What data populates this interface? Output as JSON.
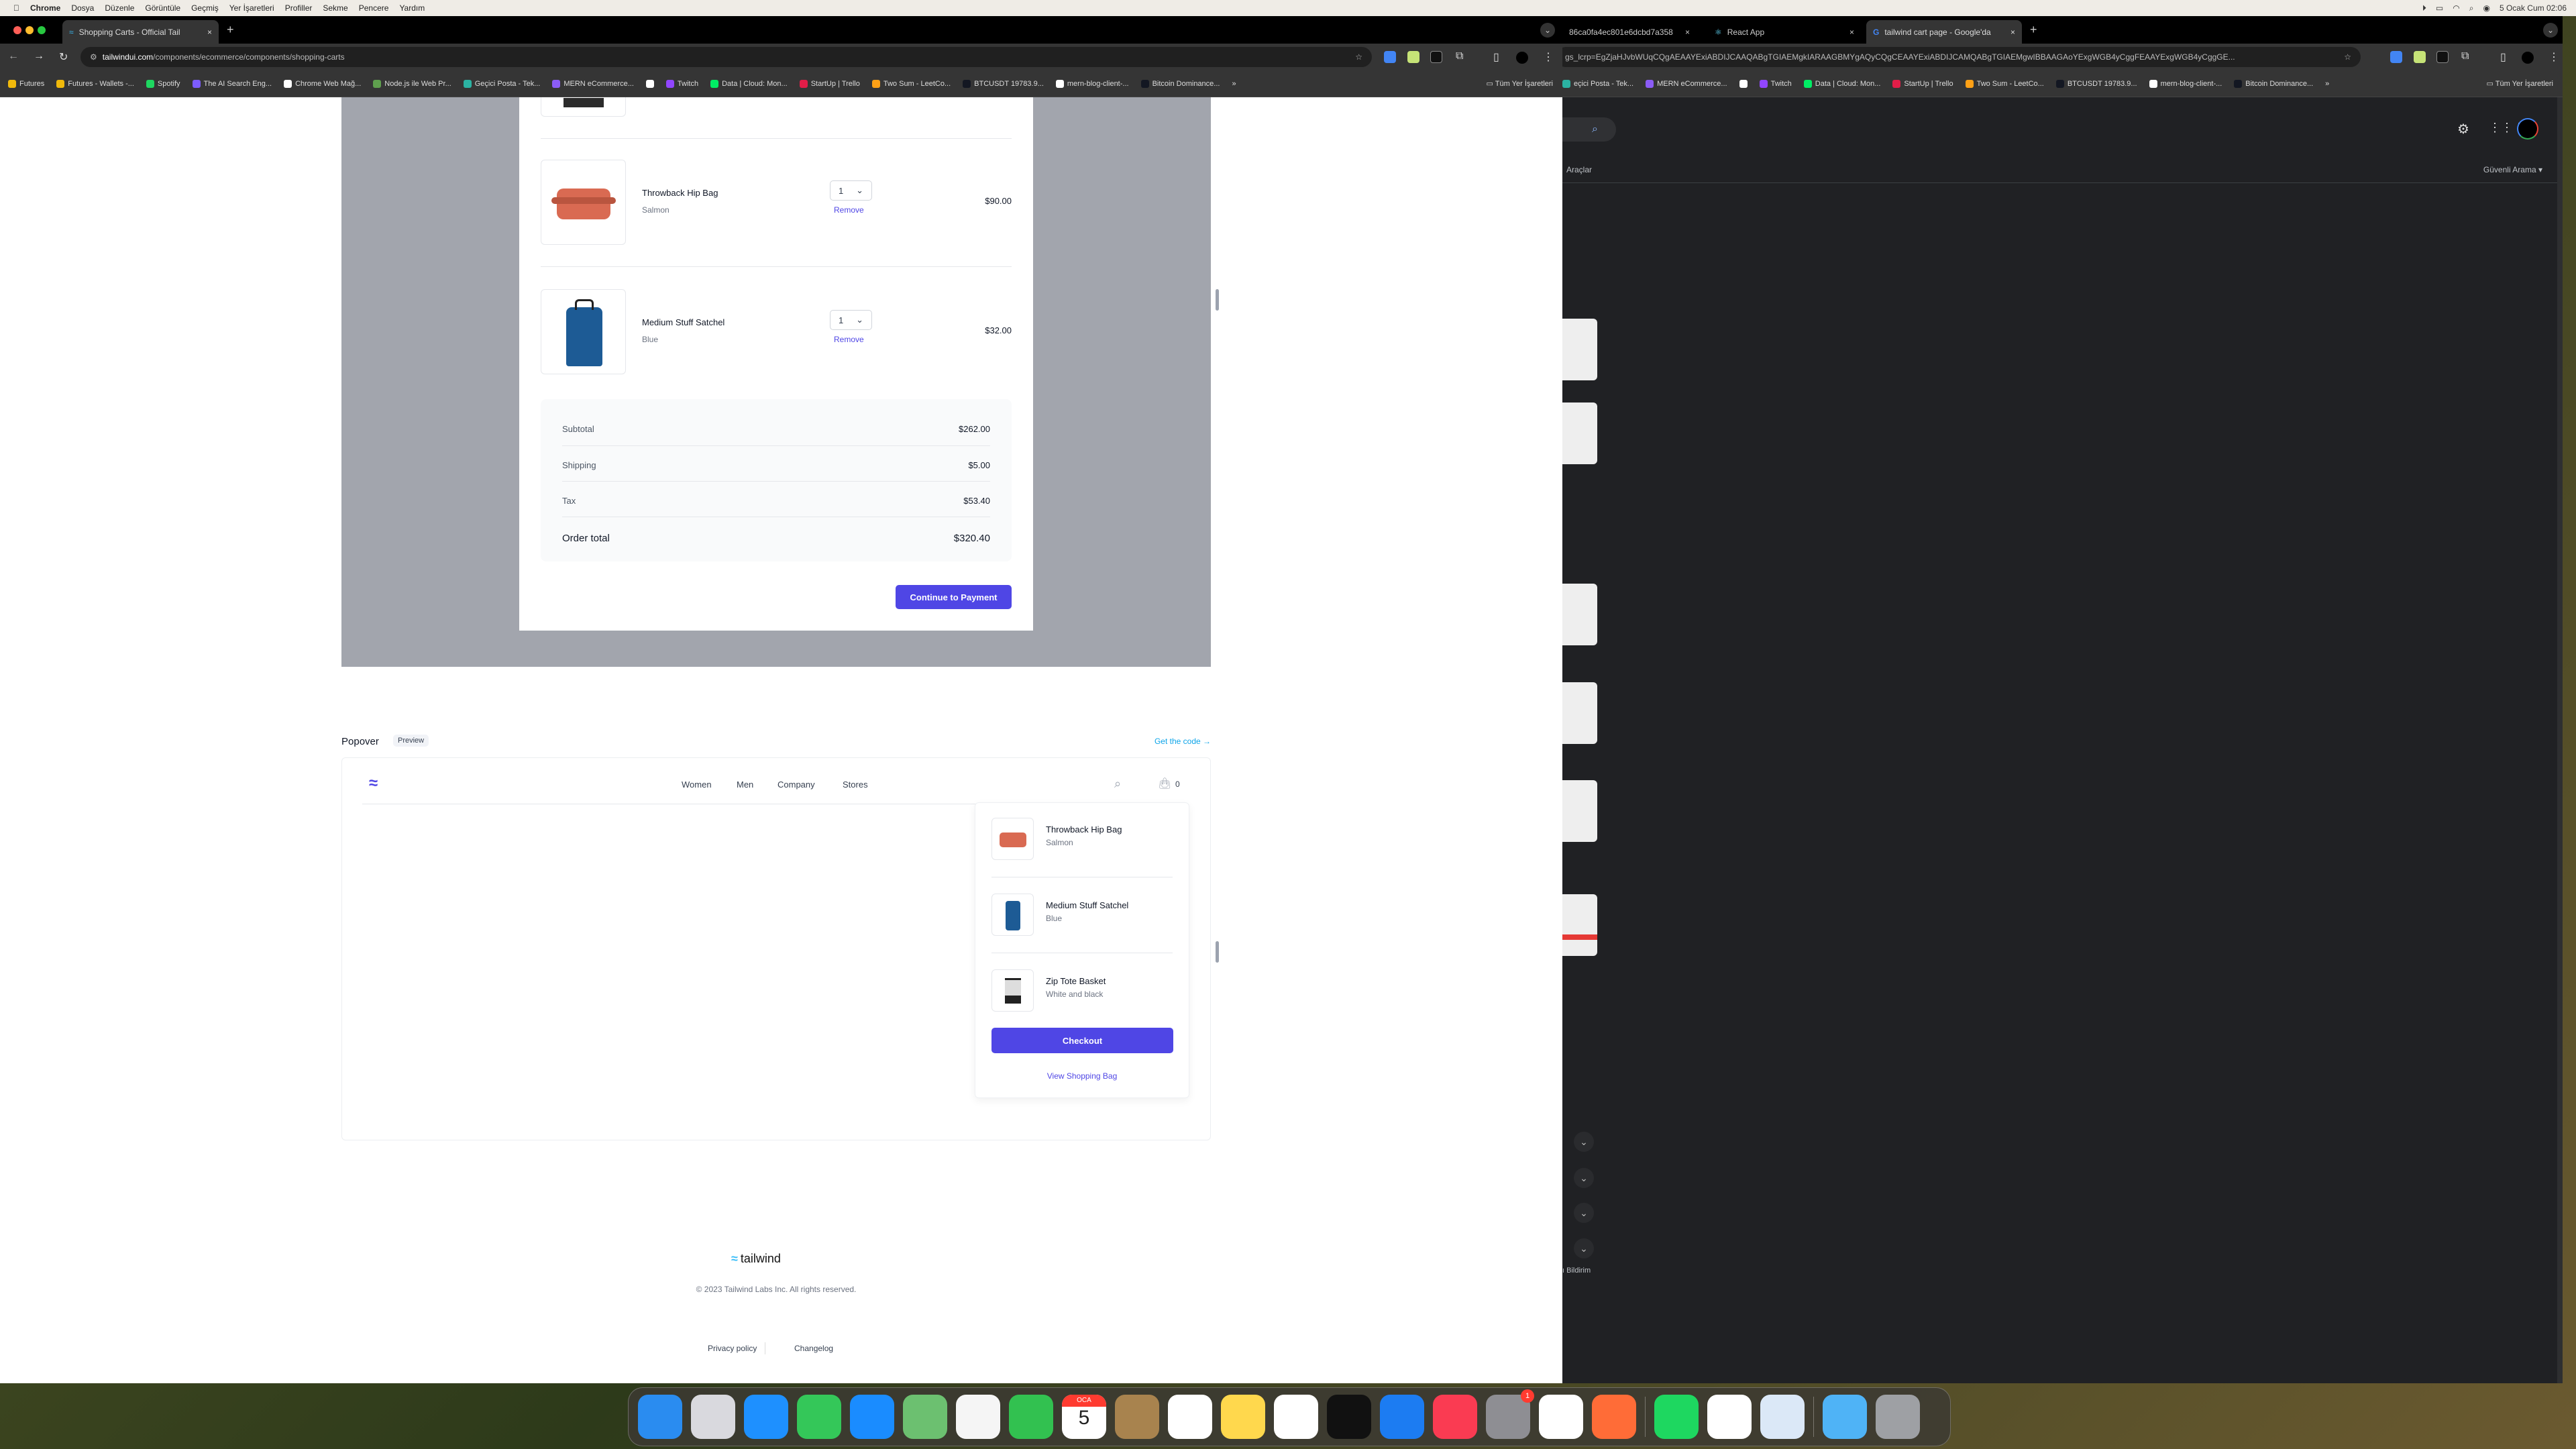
{
  "menubar": {
    "items": [
      "Chrome",
      "Dosya",
      "Düzenle",
      "Görüntüle",
      "Geçmiş",
      "Yer İşaretleri",
      "Profiller",
      "Sekme",
      "Pencere",
      "Yardım"
    ],
    "clock": "5 Ocak Cum 02:06"
  },
  "left_window": {
    "tab_title": "Shopping Carts - Official Tail",
    "url_host": "tailwindui.com",
    "url_path": "/components/ecommerce/components/shopping-carts",
    "bookmarks": [
      "Futures",
      "Futures - Wallets -...",
      "Spotify",
      "The AI Search Eng...",
      "Chrome Web Mağ...",
      "Node.js ile Web Pr...",
      "Geçici Posta - Tek...",
      "MERN eCommerce...",
      "",
      "Twitch",
      "Data | Cloud: Mon...",
      "StartUp | Trello",
      "Two Sum - LeetCo...",
      "BTCUSDT 19783.9...",
      "mern-blog-client-...",
      "Bitcoin Dominance..."
    ],
    "more": "»",
    "all_bookmarks": "Tüm Yer İşaretleri"
  },
  "cart": {
    "items": [
      {
        "name": "Throwback Hip Bag",
        "color": "Salmon",
        "qty": "1",
        "remove": "Remove",
        "price": "$90.00"
      },
      {
        "name": "Medium Stuff Satchel",
        "color": "Blue",
        "qty": "1",
        "remove": "Remove",
        "price": "$32.00"
      }
    ],
    "summary": [
      {
        "label": "Subtotal",
        "value": "$262.00"
      },
      {
        "label": "Shipping",
        "value": "$5.00"
      },
      {
        "label": "Tax",
        "value": "$53.40"
      }
    ],
    "total": {
      "label": "Order total",
      "value": "$320.40"
    },
    "continue": "Continue to Payment"
  },
  "popover_section": {
    "title": "Popover",
    "badge": "Preview",
    "get_code": "Get the code →",
    "nav": [
      "Women",
      "Men",
      "Company",
      "Stores"
    ],
    "bag_count": "0",
    "items": [
      {
        "name": "Throwback Hip Bag",
        "color": "Salmon"
      },
      {
        "name": "Medium Stuff Satchel",
        "color": "Blue"
      },
      {
        "name": "Zip Tote Basket",
        "color": "White and black"
      }
    ],
    "checkout": "Checkout",
    "view_bag": "View Shopping Bag"
  },
  "footer": {
    "logo": "tailwind",
    "copyright": "© 2023 Tailwind Labs Inc. All rights reserved.",
    "links": [
      "Privacy policy",
      "Changelog"
    ]
  },
  "right_window": {
    "tabs": [
      "86ca0fa4ec801e6dcbd7a358",
      "React App",
      "tailwind cart page - Google'da"
    ],
    "url": "gs_lcrp=EgZjaHJvbWUqCQgAEAAYExiABDIJCAAQABgTGIAEMgkIARAAGBMYgAQyCQgCEAAYExiABDIJCAMQABgTGIAEMgwIBBAAGAoYExgWGB4yCggFEAAYExgWGB4yCggGE...",
    "bookmarks": [
      "eçici Posta - Tek...",
      "MERN eCommerce...",
      "",
      "Twitch",
      "Data | Cloud: Mon...",
      "StartUp | Trello",
      "Two Sum - LeetCo...",
      "BTCUSDT 19783.9...",
      "mern-blog-client-...",
      "Bitcoin Dominance..."
    ],
    "more": "»",
    "all_bookmarks": "Tüm Yer İşaretleri",
    "tools": "Araçlar",
    "safe_search": "Güvenli Arama",
    "feedback": "ı Bildirim"
  },
  "dock": {
    "apps": [
      {
        "name": "finder",
        "color": "#2a8cf0"
      },
      {
        "name": "launchpad",
        "color": "#d9d9de"
      },
      {
        "name": "safari",
        "color": "#1e90ff"
      },
      {
        "name": "messages",
        "color": "#34c759"
      },
      {
        "name": "mail",
        "color": "#1a8cff"
      },
      {
        "name": "maps",
        "color": "#6cc070"
      },
      {
        "name": "photos",
        "color": "#f5f5f5"
      },
      {
        "name": "facetime",
        "color": "#32c150"
      },
      {
        "name": "calendar",
        "color": "#ffffff",
        "label": "OCA 5"
      },
      {
        "name": "contacts",
        "color": "#a8834e"
      },
      {
        "name": "reminders",
        "color": "#ffffff"
      },
      {
        "name": "notes",
        "color": "#ffd84d"
      },
      {
        "name": "freeform",
        "color": "#ffffff"
      },
      {
        "name": "tv",
        "color": "#111111"
      },
      {
        "name": "app-store",
        "color": "#1c7cf2"
      },
      {
        "name": "music",
        "color": "#fa3b52"
      },
      {
        "name": "system-settings",
        "color": "#8e8e93",
        "badge": "1"
      },
      {
        "name": "vscode",
        "color": "#ffffff"
      },
      {
        "name": "postman",
        "color": "#ff6c37"
      },
      {
        "sep": true
      },
      {
        "name": "spotify",
        "color": "#1ed760"
      },
      {
        "name": "chrome",
        "color": "#ffffff"
      },
      {
        "name": "preview",
        "color": "#dbe8f7"
      },
      {
        "sep": true
      },
      {
        "name": "downloads",
        "color": "#4fb3f6"
      },
      {
        "name": "trash",
        "color": "#9ea0a4"
      }
    ]
  },
  "colors": {
    "accent": "#4f46e5",
    "overlay": "#a2a5ad",
    "dark_bg": "#202124"
  }
}
